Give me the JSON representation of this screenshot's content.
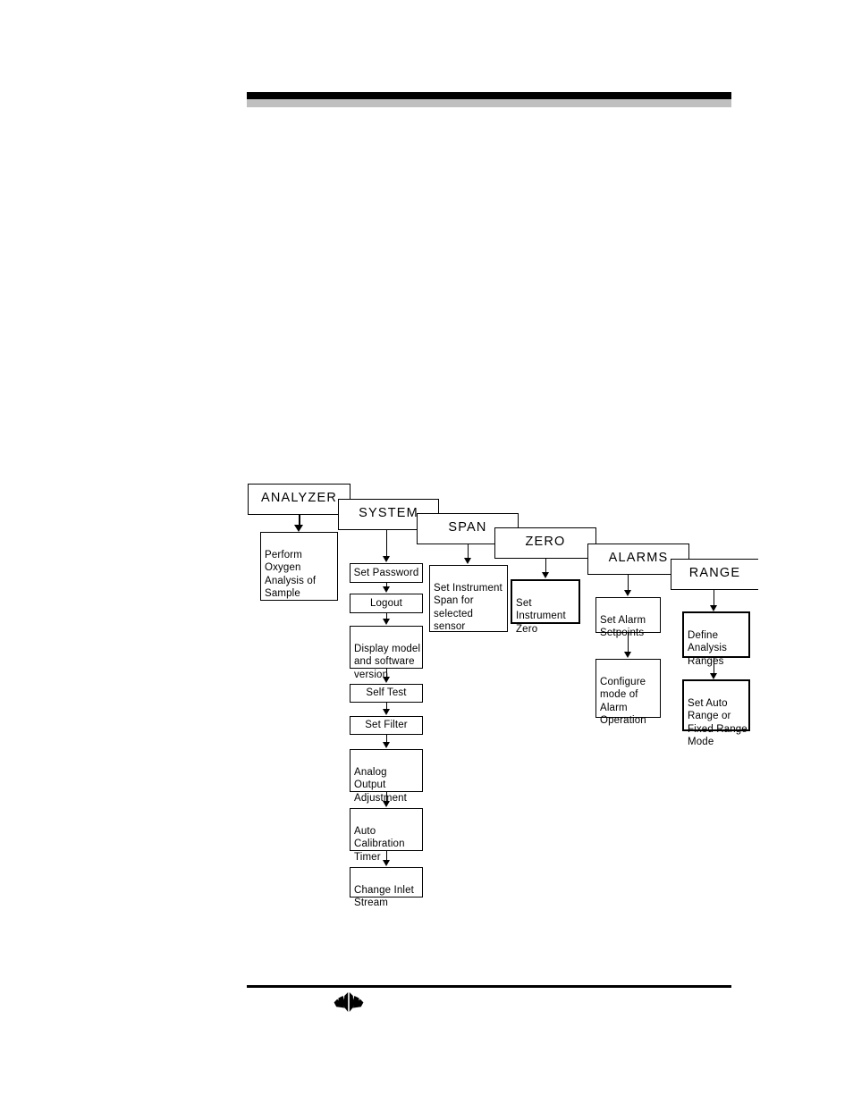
{
  "page": {
    "header_rule_color": "#000000",
    "header_accent_color": "#bfbfbf",
    "footer_rule_color": "#000000",
    "logo_name": "teledyne-leaf-logo"
  },
  "diagram": {
    "type": "menu-tree",
    "top_level": [
      {
        "id": "analyzer",
        "label": "ANALYZER"
      },
      {
        "id": "system",
        "label": "SYSTEM"
      },
      {
        "id": "span",
        "label": "SPAN"
      },
      {
        "id": "zero",
        "label": "ZERO"
      },
      {
        "id": "alarms",
        "label": "ALARMS"
      },
      {
        "id": "range",
        "label": "RANGE"
      }
    ],
    "branches": {
      "analyzer": [
        {
          "id": "perform-oxygen-analysis",
          "label": "Perform\nOxygen\nAnalysis of\nSample"
        }
      ],
      "system": [
        {
          "id": "set-password",
          "label": "Set Password"
        },
        {
          "id": "logout",
          "label": "Logout"
        },
        {
          "id": "display-model",
          "label": "Display model\nand software\nversion"
        },
        {
          "id": "self-test",
          "label": "Self Test"
        },
        {
          "id": "set-filter",
          "label": "Set Filter"
        },
        {
          "id": "analog-output",
          "label": "Analog\nOutput\nAdjustment"
        },
        {
          "id": "auto-calibration",
          "label": "Auto\nCalibration\nTimer"
        },
        {
          "id": "change-inlet-stream",
          "label": "Change Inlet\nStream"
        }
      ],
      "span": [
        {
          "id": "set-instrument-span",
          "label": "Set Instrument\nSpan for\nselected\nsensor"
        }
      ],
      "zero": [
        {
          "id": "set-instrument-zero",
          "label": "Set\nInstrument\nZero"
        }
      ],
      "alarms": [
        {
          "id": "set-alarm-setpoints",
          "label": "Set Alarm\nSetpoints"
        },
        {
          "id": "configure-alarm-mode",
          "label": "Configure\nmode of\nAlarm\nOperation"
        }
      ],
      "range": [
        {
          "id": "define-analysis-ranges",
          "label": "Define\nAnalysis\nRanges"
        },
        {
          "id": "set-auto-range",
          "label": "Set Auto\nRange or\nFixed Range\nMode"
        }
      ]
    }
  }
}
